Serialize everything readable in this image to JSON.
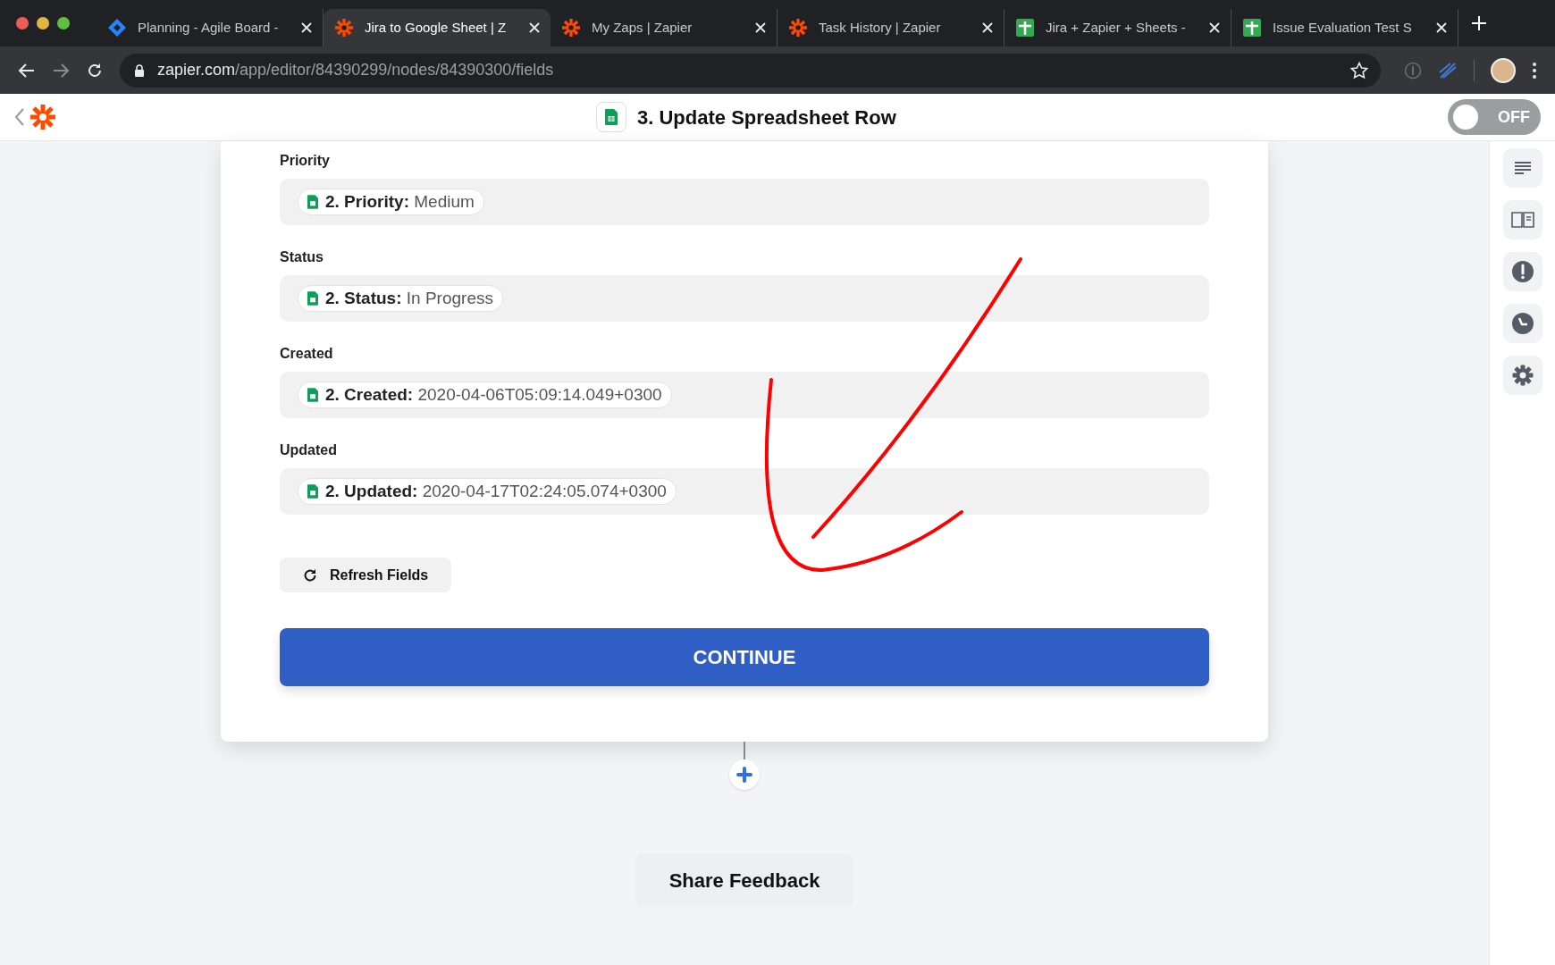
{
  "browser": {
    "tabs": [
      {
        "title": "Planning - Agile Board -",
        "kind": "jira",
        "selected": false
      },
      {
        "title": "Jira to Google Sheet | Z",
        "kind": "zapier",
        "selected": true
      },
      {
        "title": "My Zaps | Zapier",
        "kind": "zapier",
        "selected": false
      },
      {
        "title": "Task History | Zapier",
        "kind": "zapier",
        "selected": false
      },
      {
        "title": "Jira + Zapier + Sheets -",
        "kind": "sheets",
        "selected": false
      },
      {
        "title": "Issue Evaluation Test S",
        "kind": "sheets",
        "selected": false
      }
    ],
    "url": {
      "host": "zapier.com",
      "path": "/app/editor/84390299/nodes/84390300/fields"
    }
  },
  "header": {
    "title": "3. Update Spreadsheet Row",
    "toggle": {
      "label": "OFF",
      "on": false
    }
  },
  "fields": [
    {
      "label": "Priority",
      "token_key": "2. Priority:",
      "token_value": "Medium"
    },
    {
      "label": "Status",
      "token_key": "2. Status:",
      "token_value": "In Progress"
    },
    {
      "label": "Created",
      "token_key": "2. Created:",
      "token_value": "2020-04-06T05:09:14.049+0300"
    },
    {
      "label": "Updated",
      "token_key": "2. Updated:",
      "token_value": "2020-04-17T02:24:05.074+0300"
    }
  ],
  "refresh_button": "Refresh Fields",
  "continue_button": "CONTINUE",
  "feedback_button": "Share Feedback"
}
